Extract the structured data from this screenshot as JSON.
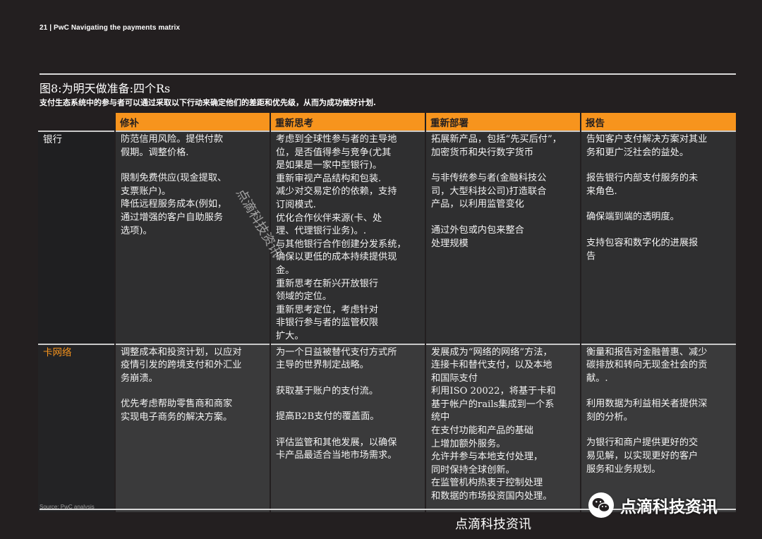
{
  "header": {
    "page_label": "21  |  PwC Navigating the payments matrix"
  },
  "figure": {
    "title": "图8:为明天做准备:四个Rs",
    "subtitle": "支付生态系统中的参与者可以通过采取以下行动来确定他们的差距和优先级，从而为成功做好计划."
  },
  "table": {
    "columns": [
      "",
      "修补",
      "重新思考",
      "重新部署",
      "报告"
    ],
    "rows": [
      {
        "label": "银行",
        "cells": [
          [
            [
              "防范信用风险。提供付款",
              "假期。调整价格."
            ],
            [
              "限制免费供应(现金提取、",
              "支票账户)。",
              "降低远程服务成本(例如，",
              "通过增强的客户自助服务",
              "选项)。"
            ]
          ],
          [
            [
              "考虑到全球性参与者的主导地",
              "位，是否值得参与竞争(尤其",
              "是如果是一家中型银行)。",
              "重新审视产品结构和包装.",
              "减少对交易定价的依赖，支持",
              "订阅模式.",
              "优化合作伙伴来源(卡、处",
              "理、代理银行业务)。.",
              "与其他银行合作创建分发系统，",
              "确保以更低的成本持续提供现",
              "金。",
              "重新思考在新兴开放银行",
              "领域的定位。",
              "重新思考定位，考虑针对",
              "非银行参与者的监管权限",
              "扩大。"
            ]
          ],
          [
            [
              "拓展新产品，包括“先买后付”，",
              "加密货币和央行数字货币"
            ],
            [
              "与非传统参与者(金融科技公",
              "司，大型科技公司)打造联合",
              "产品，以利用监管变化"
            ],
            [
              "通过外包或内包来整合",
              "处理规模"
            ]
          ],
          [
            [
              "告知客户支付解决方案对其业",
              "务和更广泛社会的益处。"
            ],
            [
              "报告银行内部支付服务的未",
              "来角色."
            ],
            [
              "确保端到端的透明度。"
            ],
            [
              "支持包容和数字化的进展报",
              "告"
            ]
          ]
        ]
      },
      {
        "label": "卡网络",
        "cells": [
          [
            [
              "调整成本和投资计划，以应对",
              "疫情引发的跨境支付和外汇业",
              "务崩溃。"
            ],
            [
              "优先考虑帮助零售商和商家",
              "实现电子商务的解决方案。"
            ]
          ],
          [
            [
              "为一个日益被替代支付方式所",
              "主导的世界制定战略。"
            ],
            [
              "获取基于账户的支付流。"
            ],
            [
              "提高B2B支付的覆盖面。"
            ],
            [
              "评估监管和其他发展，以确保",
              "卡产品最适合当地市场需求。"
            ]
          ],
          [
            [
              "发展成为“网络的网络”方法，",
              "连接卡和替代支付，以及本地",
              "和国际支付",
              "利用ISO 20022，将基于卡和",
              "基于帐户的rails集成到一个系",
              "统中",
              "在支付功能和产品的基础",
              "上增加额外服务。",
              "允许并参与本地支付处理，",
              "同时保持全球创新。",
              "在监管机构热衷于控制处理",
              "和数据的市场投资国内处理。"
            ]
          ],
          [
            [
              "衡量和报告对金融普惠、减少",
              "碳排放和转向无现金社会的贡",
              "献。."
            ],
            [
              "利用数据为利益相关者提供深",
              "刻的分析。"
            ],
            [
              "为银行和商户提供更好的交",
              "易见解，以实现更好的客户",
              "服务和业务规划。"
            ]
          ]
        ]
      }
    ]
  },
  "source_note": "Source: PwC analysis",
  "watermark": {
    "diagonal": "点滴科技资讯",
    "wechat_label": "点滴科技资讯",
    "footer": "点滴科技资讯",
    "icon": "wechat-icon"
  },
  "colors": {
    "accent": "#f7941d",
    "background": "#231f20"
  }
}
